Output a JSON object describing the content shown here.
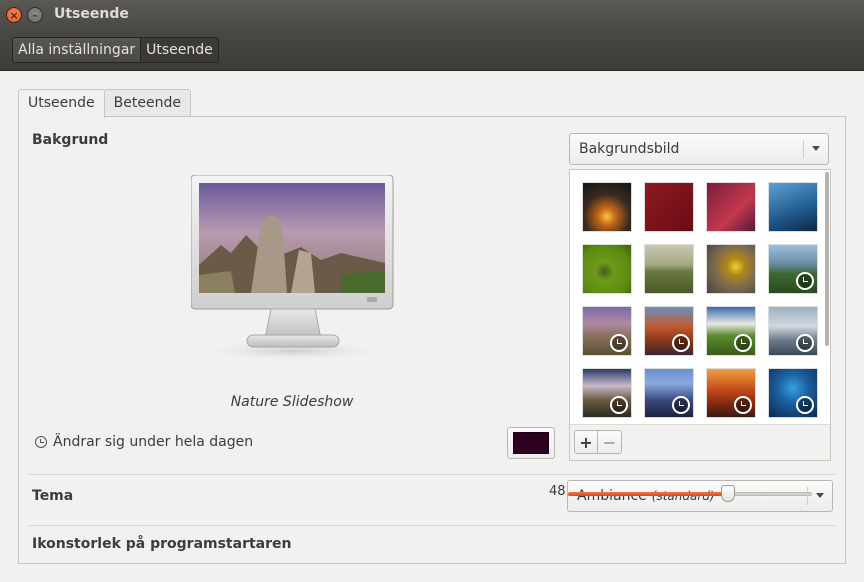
{
  "window": {
    "title": "Utseende"
  },
  "breadcrumb": {
    "items": [
      "Alla inställningar",
      "Utseende"
    ]
  },
  "tabs": [
    "Utseende",
    "Beteende"
  ],
  "background": {
    "label": "Bakgrund",
    "dropdown_value": "Bakgrundsbild",
    "preview_caption": "Nature Slideshow",
    "changes_text": "Ändrar sig under hela dagen",
    "color_swatch": "#2c001e",
    "add_label": "+",
    "remove_label": "−"
  },
  "theme": {
    "label": "Tema",
    "value": "Ambiance",
    "value_suffix": "(standard)"
  },
  "launcher": {
    "label": "Ikonstorlek på programstartaren",
    "value": "48",
    "min": 16,
    "max": 64
  },
  "wallpapers": [
    {
      "name": "sunset-wallpaper",
      "bg": "radial-gradient(circle at 50% 70%, #f8c640 0%, #c86a18 20%, #3a2a20 55%, #101515 100%)",
      "slideshow": false
    },
    {
      "name": "red-flowers-wallpaper",
      "bg": "linear-gradient(135deg, #8e1a20, #6a0c16)",
      "slideshow": false
    },
    {
      "name": "purple-gradient-wallpaper",
      "bg": "linear-gradient(135deg, #7a1e3c, #c2384e 60%, #5a1838)",
      "slideshow": false
    },
    {
      "name": "blue-ice-wallpaper",
      "bg": "linear-gradient(160deg, #5da0d4, #1f5a8c 60%, #0c2844)",
      "slideshow": false
    },
    {
      "name": "green-ubuntu-wallpaper",
      "bg": "radial-gradient(circle at 45% 55%, #4a5a20 0%, #6e9a1c 25%, #5a8a10 70%, #3c6008 100%)",
      "slideshow": false
    },
    {
      "name": "road-field-wallpaper",
      "bg": "linear-gradient(#c8c8b0 0%, #a8a888 40%, #6a7a40 55%, #4a5a28 100%)",
      "slideshow": false
    },
    {
      "name": "yellow-flower-wallpaper",
      "bg": "radial-gradient(circle at 60% 45%, #f0d030 0%, #b08818 22%, #7a6a50 55%, #4a4238 100%)",
      "slideshow": false
    },
    {
      "name": "mountain-lake-wallpaper",
      "bg": "linear-gradient(#9ac0e0 0%, #6a8aa0 40%, #3a6a30 60%, #2a4a20 100%)",
      "slideshow": true
    },
    {
      "name": "rock-formation-wallpaper",
      "bg": "linear-gradient(#7a6aa8 0%, #b08aa0 35%, #8a7060 60%, #5a5030 100%)",
      "slideshow": true
    },
    {
      "name": "red-canyon-wallpaper",
      "bg": "linear-gradient(#6a90c0 0%, #c05a30 40%, #8a3818 70%, #3a2a30 100%)",
      "slideshow": true
    },
    {
      "name": "green-valley-wallpaper",
      "bg": "linear-gradient(#3a6ab0 0%, #e8e8e0 35%, #5a8a30 60%, #3a5a18 100%)",
      "slideshow": true
    },
    {
      "name": "winter-tree-wallpaper",
      "bg": "linear-gradient(#a0b0c0 0%, #d0d8e0 40%, #6a7888 70%, #3a4858 100%)",
      "slideshow": true
    },
    {
      "name": "mountain-clouds-wallpaper",
      "bg": "linear-gradient(#2a3a6a 0%, #c8b8c8 35%, #6a5a40 65%, #2a2a20 100%)",
      "slideshow": true
    },
    {
      "name": "castle-wallpaper",
      "bg": "linear-gradient(#6a90d0 0%, #8aa8e0 30%, #3a4a80 65%, #1a2040 100%)",
      "slideshow": true
    },
    {
      "name": "canyon-sunset-wallpaper",
      "bg": "linear-gradient(#f0a040 0%, #c04818 45%, #7a2810 75%, #3a1a10 100%)",
      "slideshow": true
    },
    {
      "name": "blue-cave-wallpaper",
      "bg": "radial-gradient(circle at 50% 40%, #3aa0e0 0%, #1a60a0 40%, #0a2a50 100%)",
      "slideshow": true
    }
  ]
}
